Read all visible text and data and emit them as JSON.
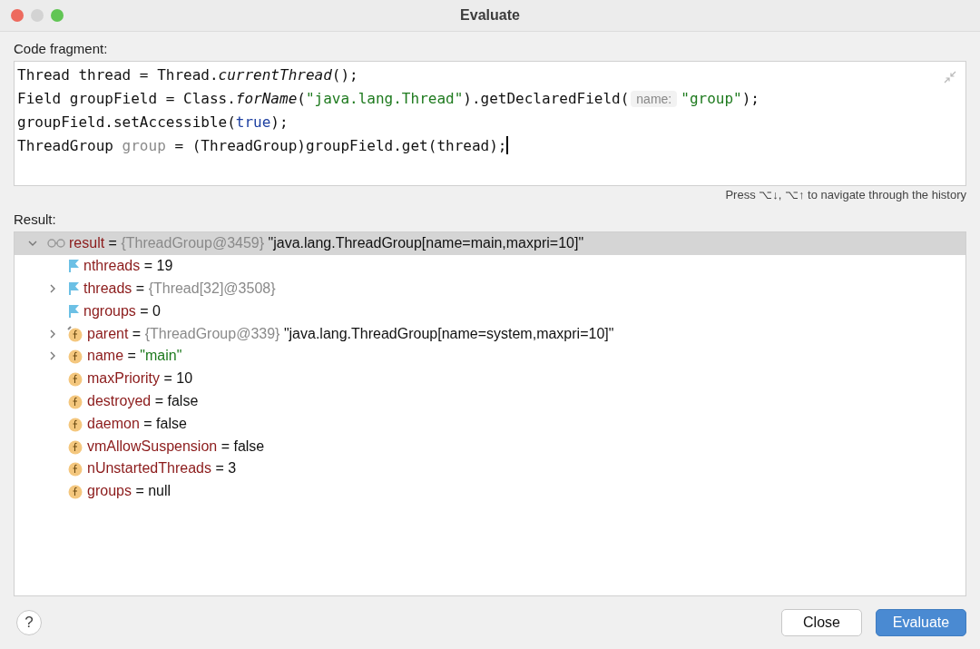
{
  "window": {
    "title": "Evaluate"
  },
  "code_label": "Code fragment:",
  "code_lines": [
    {
      "caret": false,
      "tokens": [
        {
          "kind": "plain",
          "text": "Thread thread = Thread."
        },
        {
          "kind": "italic",
          "text": "currentThread"
        },
        {
          "kind": "plain",
          "text": "();"
        }
      ]
    },
    {
      "caret": false,
      "tokens": [
        {
          "kind": "plain",
          "text": "Field groupField = Class."
        },
        {
          "kind": "italic",
          "text": "forName"
        },
        {
          "kind": "plain",
          "text": "("
        },
        {
          "kind": "string",
          "text": "\"java.lang.Thread\""
        },
        {
          "kind": "plain",
          "text": ").getDeclaredField("
        },
        {
          "kind": "hint",
          "text": "name:"
        },
        {
          "kind": "string",
          "text": "\"group\""
        },
        {
          "kind": "plain",
          "text": ");"
        }
      ]
    },
    {
      "caret": false,
      "tokens": [
        {
          "kind": "plain",
          "text": "groupField.setAccessible("
        },
        {
          "kind": "keyword",
          "text": "true"
        },
        {
          "kind": "plain",
          "text": ");"
        }
      ]
    },
    {
      "caret": true,
      "tokens": [
        {
          "kind": "plain",
          "text": "ThreadGroup "
        },
        {
          "kind": "unused",
          "text": "group"
        },
        {
          "kind": "plain",
          "text": " = (ThreadGroup)groupField.get(thread);"
        }
      ]
    }
  ],
  "history_hint": "Press ⌥↓, ⌥↑ to navigate through the history",
  "result_label": "Result:",
  "tree": [
    {
      "kind": "watch",
      "expanded": true,
      "selected": true,
      "tokens": [
        {
          "kind": "name",
          "text": "result"
        },
        {
          "kind": "plain",
          "text": "="
        },
        {
          "kind": "ref",
          "text": "{ThreadGroup@3459}"
        },
        {
          "kind": "plain",
          "text": "\"java.lang.ThreadGroup[name=main,maxpri=10]\""
        }
      ],
      "children": [
        {
          "kind": "flag",
          "selected": false,
          "tokens": [
            {
              "kind": "name",
              "text": "nthreads"
            },
            {
              "kind": "plain",
              "text": "= 19"
            }
          ]
        },
        {
          "kind": "flag",
          "expanded": false,
          "selected": false,
          "tokens": [
            {
              "kind": "name",
              "text": "threads"
            },
            {
              "kind": "plain",
              "text": "="
            },
            {
              "kind": "ref",
              "text": "{Thread[32]@3508}"
            }
          ]
        },
        {
          "kind": "flag",
          "selected": false,
          "tokens": [
            {
              "kind": "name",
              "text": "ngroups"
            },
            {
              "kind": "plain",
              "text": "= 0"
            }
          ]
        },
        {
          "kind": "field-mod",
          "expanded": false,
          "selected": false,
          "tokens": [
            {
              "kind": "name",
              "text": "parent"
            },
            {
              "kind": "plain",
              "text": "="
            },
            {
              "kind": "ref",
              "text": "{ThreadGroup@339}"
            },
            {
              "kind": "plain",
              "text": "\"java.lang.ThreadGroup[name=system,maxpri=10]\""
            }
          ]
        },
        {
          "kind": "field",
          "expanded": false,
          "selected": false,
          "tokens": [
            {
              "kind": "name",
              "text": "name"
            },
            {
              "kind": "plain",
              "text": "="
            },
            {
              "kind": "string",
              "text": "\"main\""
            }
          ]
        },
        {
          "kind": "field",
          "selected": false,
          "tokens": [
            {
              "kind": "name",
              "text": "maxPriority"
            },
            {
              "kind": "plain",
              "text": "= 10"
            }
          ]
        },
        {
          "kind": "field",
          "selected": false,
          "tokens": [
            {
              "kind": "name",
              "text": "destroyed"
            },
            {
              "kind": "plain",
              "text": "= false"
            }
          ]
        },
        {
          "kind": "field",
          "selected": false,
          "tokens": [
            {
              "kind": "name",
              "text": "daemon"
            },
            {
              "kind": "plain",
              "text": "= false"
            }
          ]
        },
        {
          "kind": "field",
          "selected": false,
          "tokens": [
            {
              "kind": "name",
              "text": "vmAllowSuspension"
            },
            {
              "kind": "plain",
              "text": "= false"
            }
          ]
        },
        {
          "kind": "field",
          "selected": false,
          "tokens": [
            {
              "kind": "name",
              "text": "nUnstartedThreads"
            },
            {
              "kind": "plain",
              "text": "= 3"
            }
          ]
        },
        {
          "kind": "field",
          "selected": false,
          "tokens": [
            {
              "kind": "name",
              "text": "groups"
            },
            {
              "kind": "plain",
              "text": "= null"
            }
          ]
        }
      ]
    }
  ],
  "help_button": "?",
  "buttons": [
    {
      "label": "Close",
      "kind": "secondary"
    },
    {
      "label": "Evaluate",
      "kind": "primary"
    }
  ]
}
